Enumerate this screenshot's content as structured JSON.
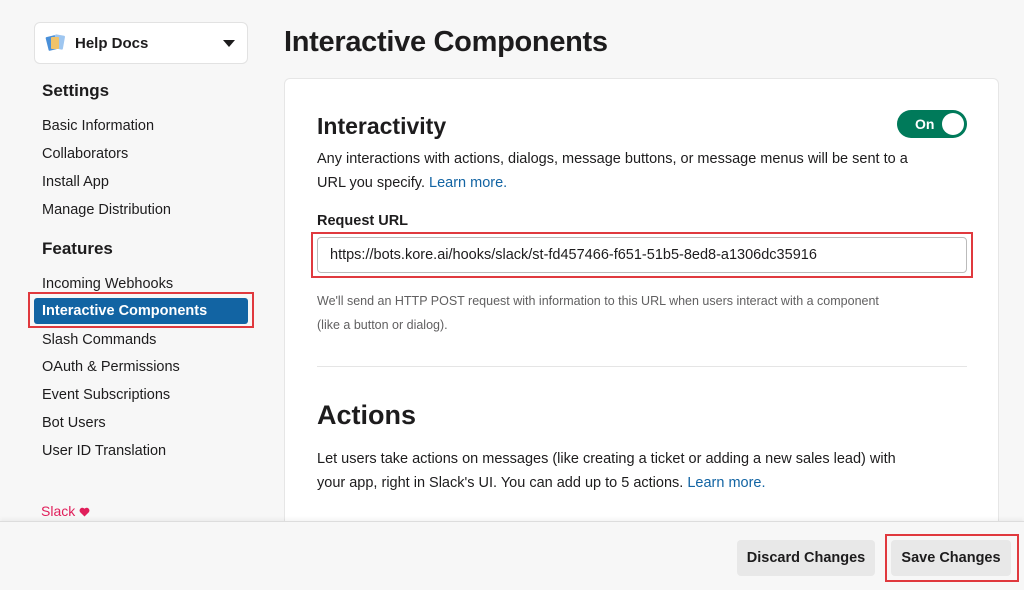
{
  "app_switcher": {
    "name": "Help Docs"
  },
  "sidebar": {
    "settings_heading": "Settings",
    "settings_items": [
      "Basic Information",
      "Collaborators",
      "Install App",
      "Manage Distribution"
    ],
    "features_heading": "Features",
    "features_items": [
      "Incoming Webhooks",
      "Interactive Components",
      "Slash Commands",
      "OAuth & Permissions",
      "Event Subscriptions",
      "Bot Users",
      "User ID Translation"
    ],
    "active_item": "Interactive Components",
    "footer_link": "Slack",
    "footer_icon": "heart-icon"
  },
  "page": {
    "title": "Interactive Components"
  },
  "interactivity": {
    "title": "Interactivity",
    "toggle_label": "On",
    "toggle_state": true,
    "description_line1": "Any interactions with actions, dialogs, message buttons, or message menus will be sent to a",
    "description_line2": "URL you specify.",
    "learn_more": "Learn more.",
    "request_url_label": "Request URL",
    "request_url_value": "https://bots.kore.ai/hooks/slack/st-fd457466-f651-51b5-8ed8-a1306dc35916",
    "help_line1": "We'll send an HTTP POST request with information to this URL when users interact with a component",
    "help_line2": "(like a button or dialog)."
  },
  "actions": {
    "title": "Actions",
    "description_line1": "Let users take actions on messages (like creating a ticket or adding a new sales lead) with",
    "description_line2": "your app, right in Slack's UI. You can add up to 5 actions.",
    "learn_more": "Learn more."
  },
  "footer": {
    "discard_label": "Discard Changes",
    "save_label": "Save Changes"
  },
  "colors": {
    "accent": "#1264a3",
    "toggle_on": "#007a5a",
    "highlight": "#e0393e",
    "slack_pink": "#e01e5a"
  }
}
